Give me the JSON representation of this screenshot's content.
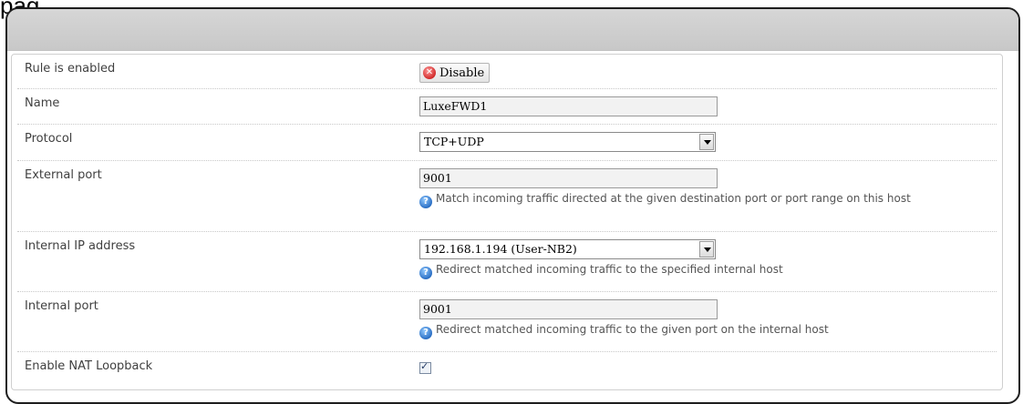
{
  "page_label": "pag",
  "form": {
    "rule_enabled": {
      "label": "Rule is enabled",
      "button_label": "Disable",
      "button_icon": "disable-x-icon"
    },
    "name": {
      "label": "Name",
      "value": "LuxeFWD1"
    },
    "protocol": {
      "label": "Protocol",
      "selected": "TCP+UDP"
    },
    "external_port": {
      "label": "External port",
      "value": "9001",
      "hint": "Match incoming traffic directed at the given destination port or port range on this host"
    },
    "internal_ip": {
      "label": "Internal IP address",
      "selected": "192.168.1.194 (User-NB2)",
      "hint": "Redirect matched incoming traffic to the specified internal host"
    },
    "internal_port": {
      "label": "Internal port",
      "value": "9001",
      "hint": "Redirect matched incoming traffic to the given port on the internal host"
    },
    "nat_loopback": {
      "label": "Enable NAT Loopback",
      "checked": true,
      "check_glyph": "✓"
    }
  },
  "icons": {
    "hint": "help-question-icon",
    "disable": "disable-x-icon"
  },
  "colors": {
    "header": "#c8c8c8",
    "frame_border": "#1e1e1e",
    "disable_icon": "#d22b2b",
    "help_icon": "#2b6fc4"
  }
}
